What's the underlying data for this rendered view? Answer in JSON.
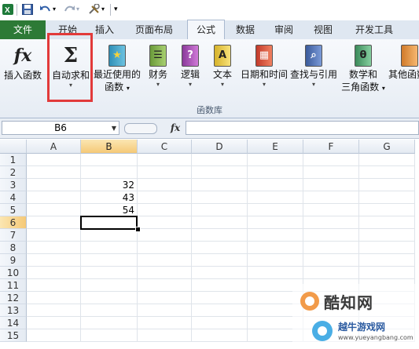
{
  "tabs": [
    {
      "label": "文件"
    },
    {
      "label": "开始"
    },
    {
      "label": "插入"
    },
    {
      "label": "页面布局"
    },
    {
      "label": "公式"
    },
    {
      "label": "数据"
    },
    {
      "label": "审阅"
    },
    {
      "label": "视图"
    },
    {
      "label": "开发工具"
    }
  ],
  "ribbon": {
    "insert_function": "插入函数",
    "autosum_line1": "自动求和",
    "recent_line1": "最近使用的",
    "recent_line2": "函数",
    "financial": "财务",
    "logical": "逻辑",
    "text": "文本",
    "datetime": "日期和时间",
    "lookup": "查找与引用",
    "math_line1": "数学和",
    "math_line2": "三角函数",
    "more": "其他函数",
    "group_label": "函数库",
    "fx_glyph": "fx",
    "sigma_glyph": "Σ"
  },
  "formula_bar": {
    "name_box": "B6",
    "fx_label": "fx",
    "value": ""
  },
  "sheet": {
    "columns": [
      "A",
      "B",
      "C",
      "D",
      "E",
      "F",
      "G"
    ],
    "rows": [
      "1",
      "2",
      "3",
      "4",
      "5",
      "6",
      "7",
      "8",
      "9",
      "10",
      "11",
      "12",
      "13",
      "14",
      "15"
    ],
    "cells": {
      "B3": "32",
      "B4": "43",
      "B5": "54"
    },
    "selected_cell": "B6"
  },
  "watermark": {
    "line1": "酷知网",
    "line2": "越牛游戏网",
    "url": "www.yueyangbang.com"
  },
  "colors": {
    "file_tab": "#2d7a36",
    "highlight": "#e23a3a",
    "selection": "#f5c977"
  }
}
